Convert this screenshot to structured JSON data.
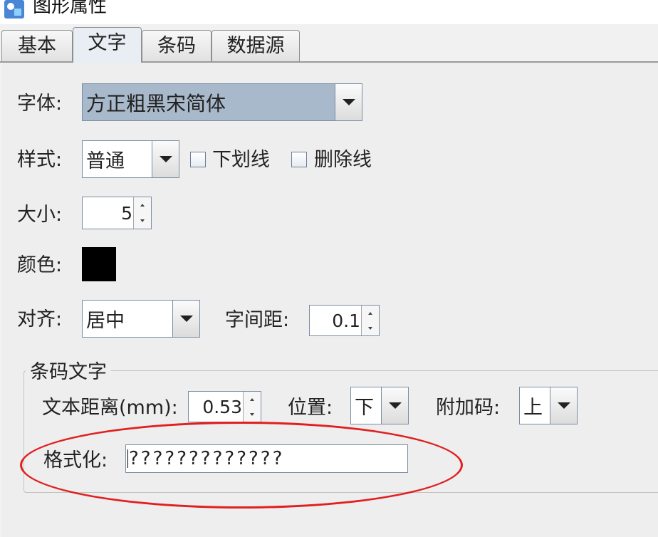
{
  "window": {
    "title": "图形属性",
    "icon": "app-icon"
  },
  "tabs": [
    {
      "label": "基本",
      "active": false
    },
    {
      "label": "文字",
      "active": true
    },
    {
      "label": "条码",
      "active": false
    },
    {
      "label": "数据源",
      "active": false
    }
  ],
  "form": {
    "font_label": "字体:",
    "font_value": "方正粗黑宋简体",
    "style_label": "样式:",
    "style_value": "普通",
    "underline_label": "下划线",
    "underline_checked": false,
    "strike_label": "删除线",
    "strike_checked": false,
    "size_label": "大小:",
    "size_value": "5",
    "color_label": "颜色:",
    "color_value": "#000000",
    "align_label": "对齐:",
    "align_value": "居中",
    "spacing_label": "字间距:",
    "spacing_value": "0.1"
  },
  "barcode_text": {
    "group_title": "条码文字",
    "distance_label": "文本距离(mm):",
    "distance_value": "0.53",
    "position_label": "位置:",
    "position_value": "下",
    "addon_label": "附加码:",
    "addon_value": "上",
    "format_label": "格式化:",
    "format_value": "?????????????"
  },
  "highlight": {
    "color": "#e11f1f",
    "target": "format-row"
  }
}
